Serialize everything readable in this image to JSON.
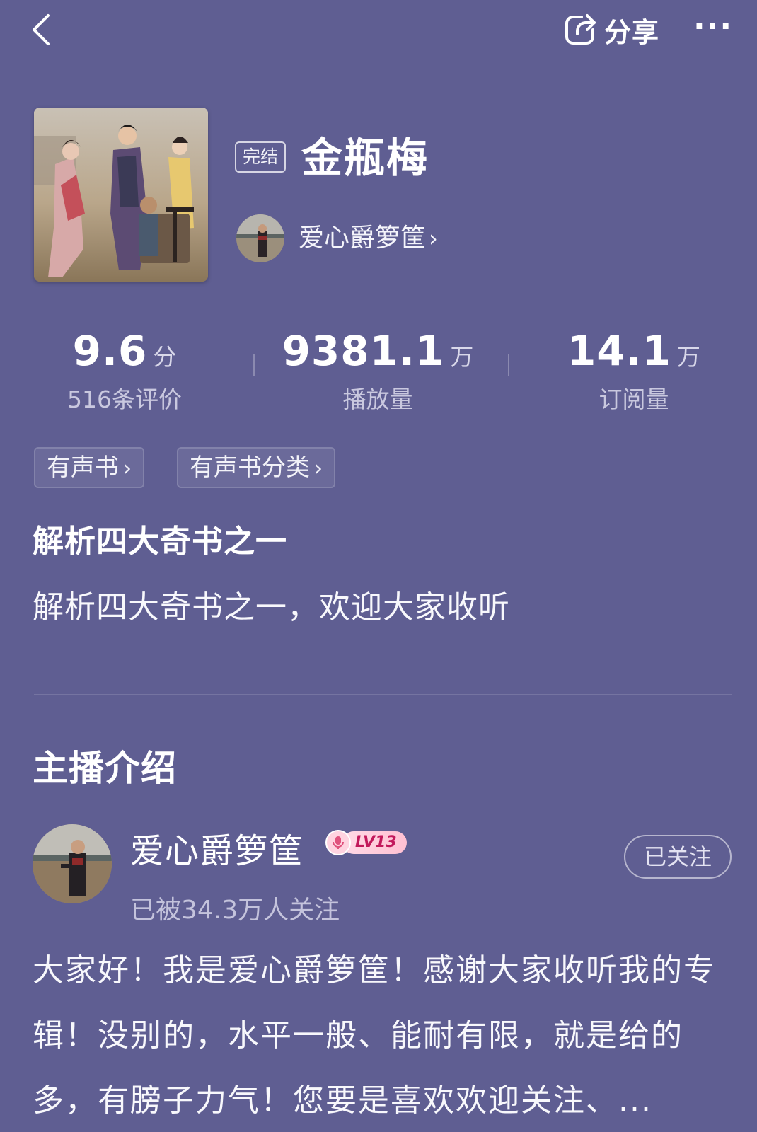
{
  "header": {
    "share_label": "分享",
    "more_label": "···"
  },
  "album": {
    "status_tag": "完结",
    "title": "金瓶梅",
    "author_name": "爱心爵箩筐",
    "author_chevron": "›"
  },
  "stats": [
    {
      "value": "9.6",
      "unit": "分",
      "label": "516条评价"
    },
    {
      "value": "9381.1",
      "unit": "万",
      "label": "播放量"
    },
    {
      "value": "14.1",
      "unit": "万",
      "label": "订阅量"
    }
  ],
  "categories": [
    {
      "label": "有声书",
      "chevron": "›"
    },
    {
      "label": "有声书分类",
      "chevron": "›"
    }
  ],
  "intro": {
    "heading": "解析四大奇书之一",
    "text": "解析四大奇书之一，欢迎大家收听"
  },
  "host": {
    "section_heading": "主播介绍",
    "name": "爱心爵箩筐",
    "level": "LV13",
    "follow_button": "已关注",
    "followers": "已被34.3万人关注",
    "bio": "大家好！我是爱心爵箩筐！感谢大家收听我的专辑！没别的，水平一般、能耐有限，就是给的多，有膀子力气！您要是喜欢欢迎关注、..."
  },
  "colors": {
    "background": "#5f5e92",
    "level_badge_text": "#c2185b"
  },
  "icons": [
    "back-arrow-icon",
    "share-icon",
    "more-icon",
    "microphone-icon",
    "chevron-right-icon"
  ]
}
